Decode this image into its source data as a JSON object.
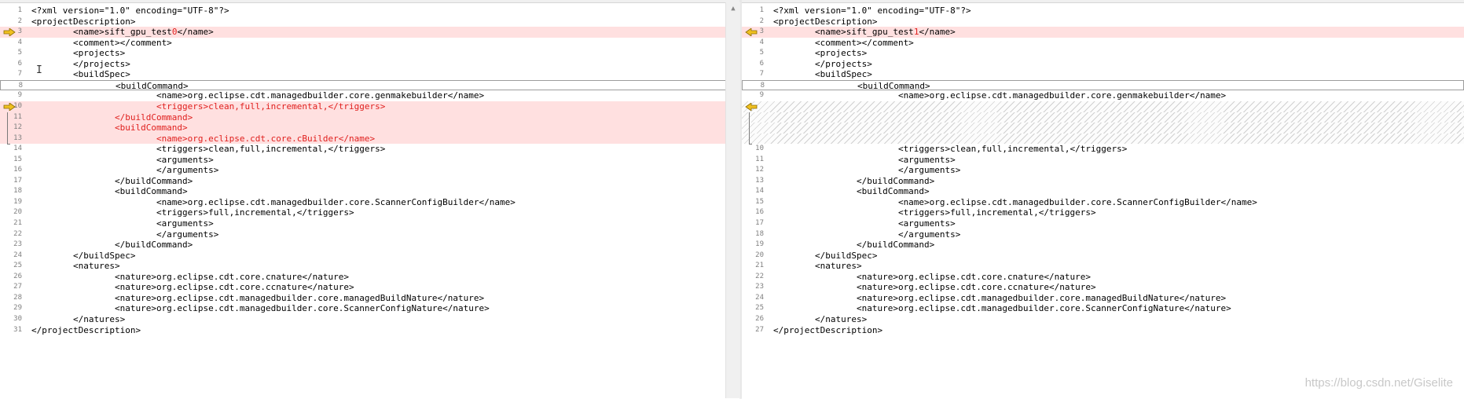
{
  "left": {
    "lines": [
      {
        "n": "1",
        "text": "<?xml version=\"1.0\" encoding=\"UTF-8\"?>",
        "kind": "normal"
      },
      {
        "n": "2",
        "text": "<projectDescription>",
        "kind": "normal"
      },
      {
        "n": "3",
        "pre": "\t<name>sift_gpu_test",
        "diff": "0",
        "post": "</name>",
        "kind": "changed",
        "marker": "arrow"
      },
      {
        "n": "4",
        "text": "\t<comment></comment>",
        "kind": "normal"
      },
      {
        "n": "5",
        "text": "\t<projects>",
        "kind": "normal"
      },
      {
        "n": "6",
        "text": "\t</projects>",
        "kind": "normal"
      },
      {
        "n": "7",
        "text": "\t<buildSpec>",
        "kind": "normal"
      },
      {
        "n": "8",
        "text": "\t\t<buildCommand>",
        "kind": "frame"
      },
      {
        "n": "9",
        "text": "\t\t\t<name>org.eclipse.cdt.managedbuilder.core.genmakebuilder</name>",
        "kind": "normal"
      },
      {
        "n": "10",
        "text": "\t\t\t<triggers>clean,full,incremental,</triggers>",
        "kind": "changed-red",
        "marker": "arrow"
      },
      {
        "n": "11",
        "text": "\t\t</buildCommand>",
        "kind": "changed-red"
      },
      {
        "n": "12",
        "text": "\t\t<buildCommand>",
        "kind": "changed-red"
      },
      {
        "n": "13",
        "text": "\t\t\t<name>org.eclipse.cdt.core.cBuilder</name>",
        "kind": "changed-red"
      },
      {
        "n": "14",
        "text": "\t\t\t<triggers>clean,full,incremental,</triggers>",
        "kind": "normal"
      },
      {
        "n": "15",
        "text": "\t\t\t<arguments>",
        "kind": "normal"
      },
      {
        "n": "16",
        "text": "\t\t\t</arguments>",
        "kind": "normal"
      },
      {
        "n": "17",
        "text": "\t\t</buildCommand>",
        "kind": "normal"
      },
      {
        "n": "18",
        "text": "\t\t<buildCommand>",
        "kind": "normal"
      },
      {
        "n": "19",
        "text": "\t\t\t<name>org.eclipse.cdt.managedbuilder.core.ScannerConfigBuilder</name>",
        "kind": "normal"
      },
      {
        "n": "20",
        "text": "\t\t\t<triggers>full,incremental,</triggers>",
        "kind": "normal"
      },
      {
        "n": "21",
        "text": "\t\t\t<arguments>",
        "kind": "normal"
      },
      {
        "n": "22",
        "text": "\t\t\t</arguments>",
        "kind": "normal"
      },
      {
        "n": "23",
        "text": "\t\t</buildCommand>",
        "kind": "normal"
      },
      {
        "n": "24",
        "text": "\t</buildSpec>",
        "kind": "normal"
      },
      {
        "n": "25",
        "text": "\t<natures>",
        "kind": "normal"
      },
      {
        "n": "26",
        "text": "\t\t<nature>org.eclipse.cdt.core.cnature</nature>",
        "kind": "normal"
      },
      {
        "n": "27",
        "text": "\t\t<nature>org.eclipse.cdt.core.ccnature</nature>",
        "kind": "normal"
      },
      {
        "n": "28",
        "text": "\t\t<nature>org.eclipse.cdt.managedbuilder.core.managedBuildNature</nature>",
        "kind": "normal"
      },
      {
        "n": "29",
        "text": "\t\t<nature>org.eclipse.cdt.managedbuilder.core.ScannerConfigNature</nature>",
        "kind": "normal"
      },
      {
        "n": "30",
        "text": "\t</natures>",
        "kind": "normal"
      },
      {
        "n": "31",
        "text": "</projectDescription>",
        "kind": "normal"
      }
    ]
  },
  "right": {
    "lines": [
      {
        "n": "1",
        "text": "<?xml version=\"1.0\" encoding=\"UTF-8\"?>",
        "kind": "normal"
      },
      {
        "n": "2",
        "text": "<projectDescription>",
        "kind": "normal"
      },
      {
        "n": "3",
        "pre": "\t<name>sift_gpu_test",
        "diff": "1",
        "post": "</name>",
        "kind": "changed",
        "marker": "arrow"
      },
      {
        "n": "4",
        "text": "\t<comment></comment>",
        "kind": "normal"
      },
      {
        "n": "5",
        "text": "\t<projects>",
        "kind": "normal"
      },
      {
        "n": "6",
        "text": "\t</projects>",
        "kind": "normal"
      },
      {
        "n": "7",
        "text": "\t<buildSpec>",
        "kind": "normal"
      },
      {
        "n": "8",
        "text": "\t\t<buildCommand>",
        "kind": "frame"
      },
      {
        "n": "9",
        "text": "\t\t\t<name>org.eclipse.cdt.managedbuilder.core.genmakebuilder</name>",
        "kind": "normal"
      },
      {
        "n": "",
        "text": "",
        "kind": "ghost",
        "marker": "arrow"
      },
      {
        "n": "",
        "text": "",
        "kind": "ghost"
      },
      {
        "n": "",
        "text": "",
        "kind": "ghost"
      },
      {
        "n": "",
        "text": "",
        "kind": "ghost"
      },
      {
        "n": "10",
        "text": "\t\t\t<triggers>clean,full,incremental,</triggers>",
        "kind": "normal"
      },
      {
        "n": "11",
        "text": "\t\t\t<arguments>",
        "kind": "normal"
      },
      {
        "n": "12",
        "text": "\t\t\t</arguments>",
        "kind": "normal"
      },
      {
        "n": "13",
        "text": "\t\t</buildCommand>",
        "kind": "normal"
      },
      {
        "n": "14",
        "text": "\t\t<buildCommand>",
        "kind": "normal"
      },
      {
        "n": "15",
        "text": "\t\t\t<name>org.eclipse.cdt.managedbuilder.core.ScannerConfigBuilder</name>",
        "kind": "normal"
      },
      {
        "n": "16",
        "text": "\t\t\t<triggers>full,incremental,</triggers>",
        "kind": "normal"
      },
      {
        "n": "17",
        "text": "\t\t\t<arguments>",
        "kind": "normal"
      },
      {
        "n": "18",
        "text": "\t\t\t</arguments>",
        "kind": "normal"
      },
      {
        "n": "19",
        "text": "\t\t</buildCommand>",
        "kind": "normal"
      },
      {
        "n": "20",
        "text": "\t</buildSpec>",
        "kind": "normal"
      },
      {
        "n": "21",
        "text": "\t<natures>",
        "kind": "normal"
      },
      {
        "n": "22",
        "text": "\t\t<nature>org.eclipse.cdt.core.cnature</nature>",
        "kind": "normal"
      },
      {
        "n": "23",
        "text": "\t\t<nature>org.eclipse.cdt.core.ccnature</nature>",
        "kind": "normal"
      },
      {
        "n": "24",
        "text": "\t\t<nature>org.eclipse.cdt.managedbuilder.core.managedBuildNature</nature>",
        "kind": "normal"
      },
      {
        "n": "25",
        "text": "\t\t<nature>org.eclipse.cdt.managedbuilder.core.ScannerConfigNature</nature>",
        "kind": "normal"
      },
      {
        "n": "26",
        "text": "\t</natures>",
        "kind": "normal"
      },
      {
        "n": "27",
        "text": "</projectDescription>",
        "kind": "normal"
      }
    ]
  },
  "watermark": "https://blog.csdn.net/Giselite",
  "colors": {
    "changed_bg": "#ffe0e0",
    "diff_text": "#e0201e",
    "arrow_fill": "#f0c020"
  },
  "icons": {
    "diff_marker": "diff-arrow-icon",
    "text_cursor": "text-cursor-icon"
  }
}
